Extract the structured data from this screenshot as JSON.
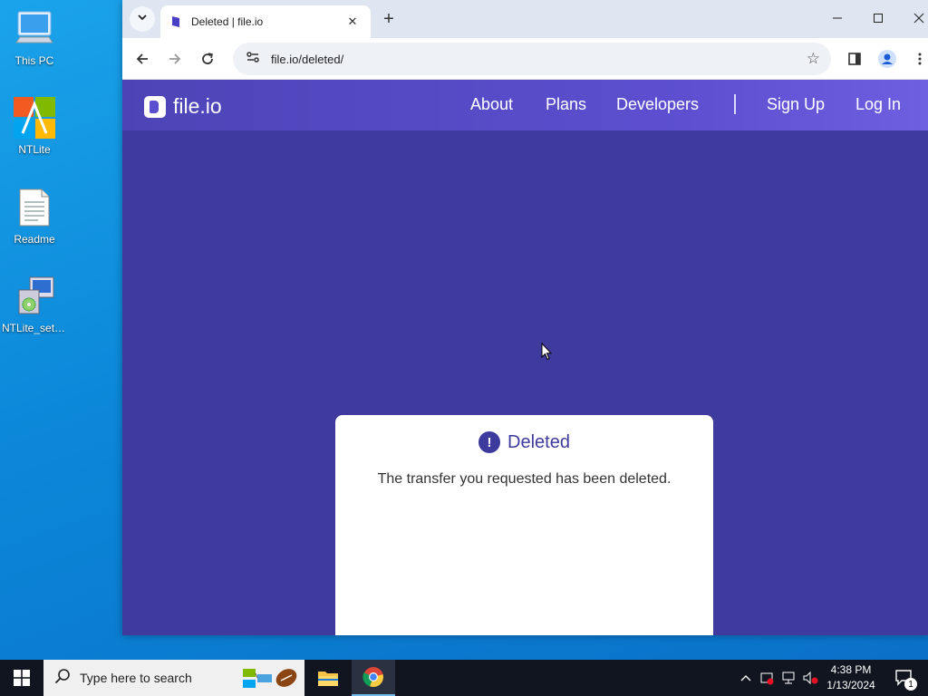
{
  "desktop": {
    "icons": [
      {
        "label": "This PC"
      },
      {
        "label": "NTLite"
      },
      {
        "label": "Readme"
      },
      {
        "label": "NTLite_setu..."
      }
    ]
  },
  "browser": {
    "tab": {
      "title": "Deleted | file.io"
    },
    "address": {
      "url": "file.io/deleted/"
    }
  },
  "site": {
    "logo_text": "file.io",
    "nav": {
      "about": "About",
      "plans": "Plans",
      "developers": "Developers",
      "signup": "Sign Up",
      "login": "Log In"
    },
    "card": {
      "icon_glyph": "!",
      "title": "Deleted",
      "message": "The transfer you requested has been deleted."
    },
    "colors": {
      "brand": "#3f3a9e",
      "header": "#5a4fd0"
    }
  },
  "taskbar": {
    "search_placeholder": "Type here to search",
    "time": "4:38 PM",
    "date": "1/13/2024",
    "notification_count": "1"
  }
}
